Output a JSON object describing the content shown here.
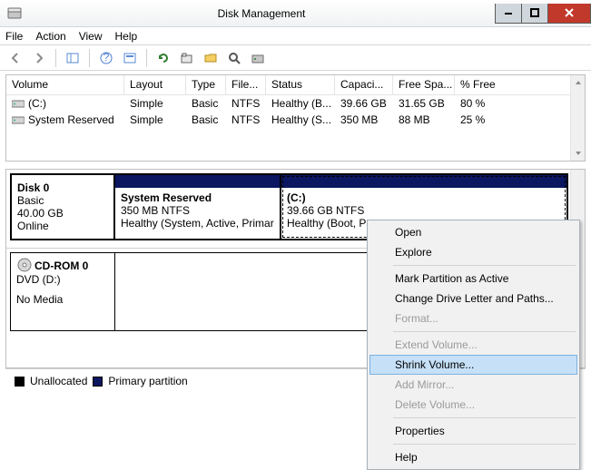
{
  "window": {
    "title": "Disk Management"
  },
  "menu": {
    "file": "File",
    "action": "Action",
    "view": "View",
    "help": "Help"
  },
  "columns": {
    "volume": "Volume",
    "layout": "Layout",
    "type": "Type",
    "fs": "File...",
    "status": "Status",
    "capacity": "Capaci...",
    "free": "Free Spa...",
    "pctfree": "% Free"
  },
  "volumes": [
    {
      "name": "(C:)",
      "layout": "Simple",
      "type": "Basic",
      "fs": "NTFS",
      "status": "Healthy (B...",
      "capacity": "39.66 GB",
      "free": "31.65 GB",
      "pctfree": "80 %"
    },
    {
      "name": "System Reserved",
      "layout": "Simple",
      "type": "Basic",
      "fs": "NTFS",
      "status": "Healthy (S...",
      "capacity": "350 MB",
      "free": "88 MB",
      "pctfree": "25 %"
    }
  ],
  "disk0": {
    "name": "Disk 0",
    "type": "Basic",
    "size": "40.00 GB",
    "state": "Online",
    "parts": [
      {
        "title": "System Reserved",
        "line2": "350 MB NTFS",
        "line3": "Healthy (System, Active, Primar"
      },
      {
        "title": "(C:)",
        "line2": "39.66 GB NTFS",
        "line3": "Healthy (Boot, Pa"
      }
    ]
  },
  "cdrom": {
    "name": "CD-ROM 0",
    "line2": "DVD (D:)",
    "line3": "No Media"
  },
  "legend": {
    "unalloc": "Unallocated",
    "primary": "Primary partition"
  },
  "ctx": {
    "open": "Open",
    "explore": "Explore",
    "mark": "Mark Partition as Active",
    "change": "Change Drive Letter and Paths...",
    "format": "Format...",
    "extend": "Extend Volume...",
    "shrink": "Shrink Volume...",
    "mirror": "Add Mirror...",
    "delete": "Delete Volume...",
    "props": "Properties",
    "help": "Help"
  }
}
